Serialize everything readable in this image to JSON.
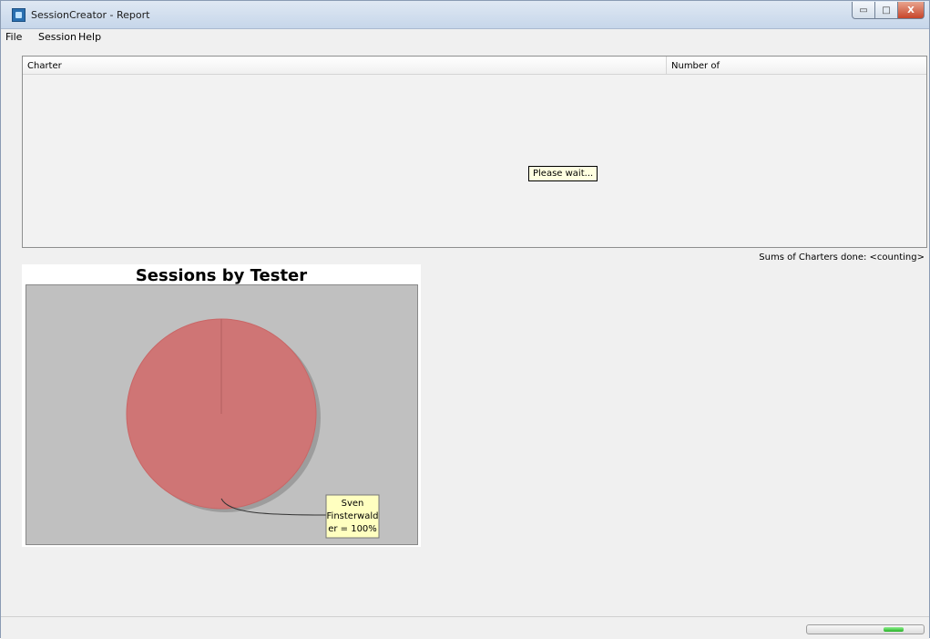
{
  "window": {
    "title": "SessionCreator - Report",
    "minimize_glyph": "▭",
    "maximize_glyph": "□",
    "close_glyph": "X"
  },
  "menu": {
    "items": [
      {
        "label": "File"
      },
      {
        "label": "Session"
      },
      {
        "label": "Help"
      }
    ]
  },
  "charter_table": {
    "columns": [
      "Charter",
      "Number of"
    ],
    "loading_text": "Please wait..."
  },
  "sums_label": "Sums of Charters done: <counting>",
  "chart_data": {
    "type": "pie",
    "title": "Sessions by Tester",
    "slices": [
      {
        "label": "Sven Finsterwalder",
        "value": 100,
        "color": "#cf7575"
      }
    ],
    "label_lines": [
      "Sven",
      "Finsterwald",
      "er = 100%"
    ]
  },
  "status": {
    "progress_indeterminate": true
  },
  "colors": {
    "pie": "#cf7575",
    "plot_background": "#c0c0c0",
    "tooltip": "#ffffe1"
  }
}
